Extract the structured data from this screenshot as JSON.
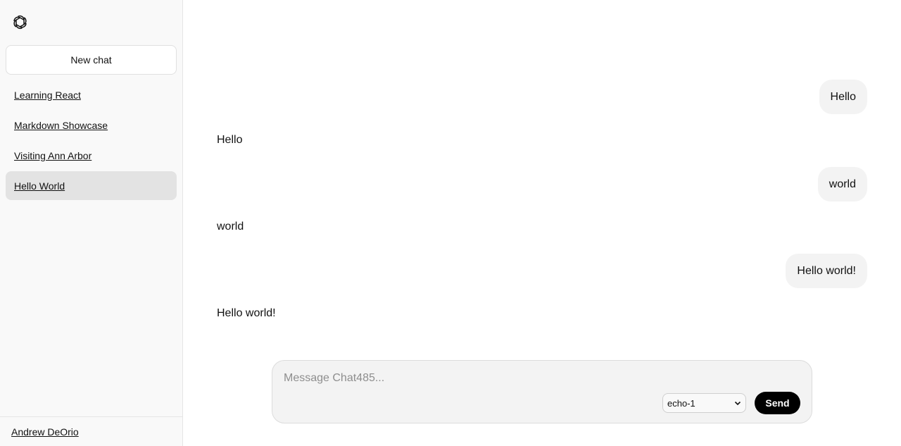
{
  "sidebar": {
    "logo_icon": "openai-logo-icon",
    "new_chat_label": "New chat",
    "chats": [
      {
        "label": "Learning React",
        "active": false
      },
      {
        "label": "Markdown Showcase",
        "active": false
      },
      {
        "label": "Visiting Ann Arbor",
        "active": false
      },
      {
        "label": "Hello World",
        "active": true
      }
    ],
    "user_name": "Andrew DeOrio"
  },
  "conversation": {
    "messages": [
      {
        "role": "user",
        "text": "Hello"
      },
      {
        "role": "assistant",
        "text": "Hello"
      },
      {
        "role": "user",
        "text": "world"
      },
      {
        "role": "assistant",
        "text": "world"
      },
      {
        "role": "user",
        "text": "Hello world!"
      },
      {
        "role": "assistant",
        "text": "Hello world!"
      }
    ]
  },
  "composer": {
    "placeholder": "Message Chat485...",
    "value": "",
    "model_selected": "echo-1",
    "send_label": "Send"
  },
  "colors": {
    "sidebar_bg": "#f9f9f9",
    "active_chat_bg": "#e3e3e3",
    "bubble_bg": "#f3f3f3",
    "send_bg": "#000000"
  }
}
